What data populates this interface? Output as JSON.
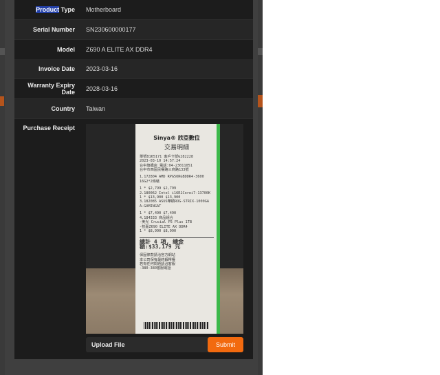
{
  "details": {
    "rows": [
      {
        "label_pre": "Product",
        "label_post": " Type",
        "value": "Motherboard"
      },
      {
        "label": "Serial Number",
        "value": "SN230600000177"
      },
      {
        "label": "Model",
        "value": "Z690 A ELITE AX DDR4"
      },
      {
        "label": "Invoice Date",
        "value": "2023-03-16"
      },
      {
        "label": "Warranty Expiry Date",
        "value": "2028-03-16"
      },
      {
        "label": "Country",
        "value": "Taiwan"
      }
    ],
    "receipt_label": "Purchase Receipt"
  },
  "receipt": {
    "logo": "Sinya® 欣亞數位",
    "heading": "交易明細",
    "lines": [
      "單號8165171 客戶卡號G282228",
      "2023-03-10 14:57:24",
      "台中旗艦店 電話:04-23011051",
      "台中市西區民權路三商路133號",
      "1.172804 AMD RPG5ORGBDDR4-3600",
      "16G2*2條裝",
      "1 *    $2,799      $2,799",
      "2.180062 Intel i16R1Corei7-13700K",
      "1 *    $13,900    $13,900",
      "3.182085 ASUS華碩ROG-STRIX-1000GA",
      "A-GAMINGAT",
      "1 *    $7,490      $7,490",
      "4.184333 商品組合",
      "-美光 Crucial P5 Plus 1TB",
      "-技嘉Z690 ELITE AX DDR4",
      "1 *    $8,990      $8,990"
    ],
    "total": "總計 4 項, 總金額:$33,179 元",
    "footer": [
      "保固條款請洽官方網站",
      "本公司保有最終解釋權",
      "若有任何問題請洽客服",
      "-380-380客服電話"
    ]
  },
  "upload": {
    "label": "Upload File",
    "submit": "Submit"
  },
  "colors": {
    "accent": "#f26a0f",
    "highlight": "#2340a8"
  }
}
